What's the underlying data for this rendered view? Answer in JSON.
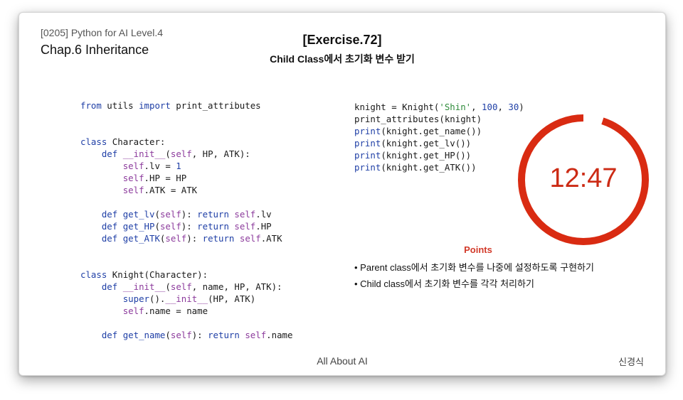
{
  "header": {
    "course": "[0205] Python for AI Level.4",
    "chapter": "Chap.6 Inheritance",
    "title": "[Exercise.72]",
    "subtitle": "Child Class에서 초기화 변수 받기"
  },
  "code_left": [
    [
      [
        "kw",
        "from"
      ],
      [
        "t",
        " utils "
      ],
      [
        "kw",
        "import"
      ],
      [
        "t",
        " print_attributes"
      ]
    ],
    [],
    [],
    [
      [
        "kw",
        "class"
      ],
      [
        "t",
        " Character:"
      ]
    ],
    [
      [
        "t",
        "    "
      ],
      [
        "kw",
        "def"
      ],
      [
        "t",
        " "
      ],
      [
        "sf",
        "__init__"
      ],
      [
        "t",
        "("
      ],
      [
        "sf",
        "self"
      ],
      [
        "t",
        ", HP, ATK):"
      ]
    ],
    [
      [
        "t",
        "        "
      ],
      [
        "sf",
        "self"
      ],
      [
        "t",
        ".lv = "
      ],
      [
        "num",
        "1"
      ]
    ],
    [
      [
        "t",
        "        "
      ],
      [
        "sf",
        "self"
      ],
      [
        "t",
        ".HP = HP"
      ]
    ],
    [
      [
        "t",
        "        "
      ],
      [
        "sf",
        "self"
      ],
      [
        "t",
        ".ATK = ATK"
      ]
    ],
    [],
    [
      [
        "t",
        "    "
      ],
      [
        "kw",
        "def"
      ],
      [
        "t",
        " "
      ],
      [
        "kw",
        "get_lv"
      ],
      [
        "t",
        "("
      ],
      [
        "sf",
        "self"
      ],
      [
        "t",
        "): "
      ],
      [
        "kw",
        "return"
      ],
      [
        "t",
        " "
      ],
      [
        "sf",
        "self"
      ],
      [
        "t",
        ".lv"
      ]
    ],
    [
      [
        "t",
        "    "
      ],
      [
        "kw",
        "def"
      ],
      [
        "t",
        " "
      ],
      [
        "kw",
        "get_HP"
      ],
      [
        "t",
        "("
      ],
      [
        "sf",
        "self"
      ],
      [
        "t",
        "): "
      ],
      [
        "kw",
        "return"
      ],
      [
        "t",
        " "
      ],
      [
        "sf",
        "self"
      ],
      [
        "t",
        ".HP"
      ]
    ],
    [
      [
        "t",
        "    "
      ],
      [
        "kw",
        "def"
      ],
      [
        "t",
        " "
      ],
      [
        "kw",
        "get_ATK"
      ],
      [
        "t",
        "("
      ],
      [
        "sf",
        "self"
      ],
      [
        "t",
        "): "
      ],
      [
        "kw",
        "return"
      ],
      [
        "t",
        " "
      ],
      [
        "sf",
        "self"
      ],
      [
        "t",
        ".ATK"
      ]
    ],
    [],
    [],
    [
      [
        "kw",
        "class"
      ],
      [
        "t",
        " Knight(Character):"
      ]
    ],
    [
      [
        "t",
        "    "
      ],
      [
        "kw",
        "def"
      ],
      [
        "t",
        " "
      ],
      [
        "sf",
        "__init__"
      ],
      [
        "t",
        "("
      ],
      [
        "sf",
        "self"
      ],
      [
        "t",
        ", name, HP, ATK):"
      ]
    ],
    [
      [
        "t",
        "        "
      ],
      [
        "kw",
        "super"
      ],
      [
        "t",
        "()."
      ],
      [
        "sf",
        "__init__"
      ],
      [
        "t",
        "(HP, ATK)"
      ]
    ],
    [
      [
        "t",
        "        "
      ],
      [
        "sf",
        "self"
      ],
      [
        "t",
        ".name = name"
      ]
    ],
    [],
    [
      [
        "t",
        "    "
      ],
      [
        "kw",
        "def"
      ],
      [
        "t",
        " "
      ],
      [
        "kw",
        "get_name"
      ],
      [
        "t",
        "("
      ],
      [
        "sf",
        "self"
      ],
      [
        "t",
        "): "
      ],
      [
        "kw",
        "return"
      ],
      [
        "t",
        " "
      ],
      [
        "sf",
        "self"
      ],
      [
        "t",
        ".name"
      ]
    ]
  ],
  "code_right": [
    [
      [
        "t",
        "knight = Knight("
      ],
      [
        "str",
        "'Shin'"
      ],
      [
        "t",
        ", "
      ],
      [
        "num",
        "100"
      ],
      [
        "t",
        ", "
      ],
      [
        "num",
        "30"
      ],
      [
        "t",
        ")"
      ]
    ],
    [
      [
        "t",
        "print_attributes(knight)"
      ]
    ],
    [
      [
        "kw",
        "print"
      ],
      [
        "t",
        "(knight.get_name())"
      ]
    ],
    [
      [
        "kw",
        "print"
      ],
      [
        "t",
        "(knight.get_lv())"
      ]
    ],
    [
      [
        "kw",
        "print"
      ],
      [
        "t",
        "(knight.get_HP())"
      ]
    ],
    [
      [
        "kw",
        "print"
      ],
      [
        "t",
        "(knight.get_ATK())"
      ]
    ]
  ],
  "timer": {
    "text": "12:47",
    "progress": 0.95,
    "color": "#d92b12"
  },
  "points": {
    "title": "Points",
    "items": [
      "• Parent class에서 초기화 변수를 나중에 설정하도록 구현하기",
      "• Child class에서 초기화 변수를 각각 처리하기"
    ]
  },
  "footer": {
    "center": "All About AI",
    "right": "신경식"
  },
  "colors": {
    "keyword": "#1f3fa6",
    "self": "#8c3b9c",
    "string": "#2e8b3a",
    "accent": "#d23a2a"
  }
}
